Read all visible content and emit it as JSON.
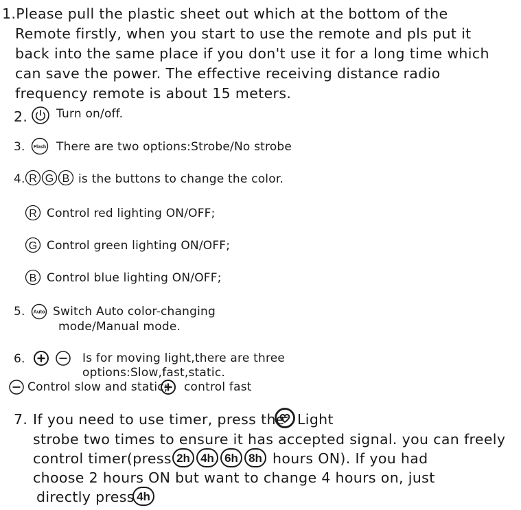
{
  "item1": {
    "line1": "1.Please pull the plastic sheet out which at the bottom of the",
    "line2": "Remote firstly, when you start to use the remote and pls put it",
    "line3": "back into the same place if you don't use it for a long time which",
    "line4": "can save the power. The effective receiving distance radio",
    "line5": "frequency remote is about 15 meters."
  },
  "item2": {
    "num": "2.",
    "text": "Turn on/off."
  },
  "item3": {
    "num": "3.",
    "icon_label": "Flash",
    "text": "There are two options:Strobe/No strobe"
  },
  "item4": {
    "num": "4.",
    "letters": [
      "R",
      "G",
      "B"
    ],
    "text": "is the buttons to change the color.",
    "sub": [
      {
        "letter": "R",
        "text": "Control red lighting ON/OFF;"
      },
      {
        "letter": "G",
        "text": "Control green lighting ON/OFF;"
      },
      {
        "letter": "B",
        "text": "Control blue lighting ON/OFF;"
      }
    ]
  },
  "item5": {
    "num": "5.",
    "icon_label": "Auto",
    "text1": "Switch Auto color-changing",
    "text2": "mode/Manual mode."
  },
  "item6": {
    "num": "6.",
    "text1": "Is for moving light,there are three",
    "text2": "options:Slow,fast,static.",
    "text3a": "Control slow and static;",
    "text3b": "control fast"
  },
  "item7": {
    "num": "7.",
    "line1": "If you need to use timer, press the",
    "line1b": "Light",
    "line2": "strobe two times to ensure it has accepted signal. you can freely",
    "line3a": "control timer(press",
    "line3b": "hours ON). If you had",
    "line4": "choose 2 hours ON but want to change 4 hours on, just",
    "line5": "directly press",
    "timers": [
      "2h",
      "4h",
      "6h",
      "8h"
    ]
  },
  "icons": {
    "power": "power-icon",
    "flash": "flash-button-icon",
    "auto": "auto-button-icon",
    "plus": "plus-circle-icon",
    "minus": "minus-circle-icon",
    "timer": "timer-heart-icon"
  },
  "colors": {
    "text": "#1a1a1a",
    "background": "#ffffff"
  }
}
